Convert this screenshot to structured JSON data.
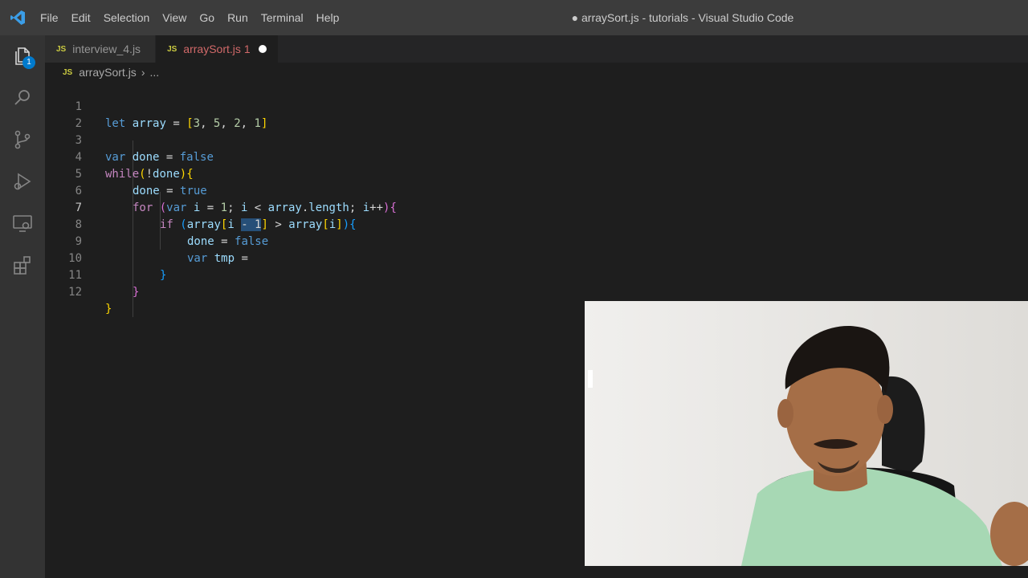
{
  "menu": [
    "File",
    "Edit",
    "Selection",
    "View",
    "Go",
    "Run",
    "Terminal",
    "Help"
  ],
  "window_title": "● arraySort.js - tutorials - Visual Studio Code",
  "activity": {
    "explorer_badge": "1",
    "icons": [
      "files-icon",
      "search-icon",
      "source-control-icon",
      "run-debug-icon",
      "remote-explorer-icon",
      "extensions-icon"
    ]
  },
  "tabs": [
    {
      "lang": "JS",
      "label": "interview_4.js"
    },
    {
      "lang": "JS",
      "label": "arraySort.js",
      "problems": "1"
    }
  ],
  "breadcrumb": {
    "lang": "JS",
    "file": "arraySort.js",
    "rest": "..."
  },
  "editor": {
    "line_numbers": [
      "1",
      "2",
      "3",
      "4",
      "5",
      "6",
      "7",
      "8",
      "9",
      "10",
      "11",
      "12"
    ],
    "current_line": 7,
    "tokens": {
      "l1_let": "let",
      "l1_array": "array",
      "l1_eq": " = ",
      "l1_ob": "[",
      "l1_n1": "3",
      "l1_c1": ", ",
      "l1_n2": "5",
      "l1_c2": ", ",
      "l1_n3": "2",
      "l1_c3": ", ",
      "l1_n4": "1",
      "l1_cb": "]",
      "l3_var": "var",
      "l3_done": "done",
      "l3_eq": " = ",
      "l3_false": "false",
      "l4_while": "while",
      "l4_op": "(",
      "l4_not": "!",
      "l4_done": "done",
      "l4_cp": ")",
      "l4_ob": "{",
      "l5_done": "done",
      "l5_eq": " = ",
      "l5_true": "true",
      "l6_for": "for",
      "l6_op": "(",
      "l6_var": "var",
      "l6_i": "i",
      "l6_eq": " = ",
      "l6_n1": "1",
      "l6_semi": "; ",
      "l6_i2": "i",
      "l6_lt": " < ",
      "l6_arr": "array",
      "l6_dot": ".",
      "l6_len": "length",
      "l6_semi2": "; ",
      "l6_i3": "i",
      "l6_inc": "++",
      "l6_cp": ")",
      "l6_ob": "{",
      "l7_if": "if",
      "l7_op": "(",
      "l7_arr": "array",
      "l7_sb": "[",
      "l7_i": "i ",
      "l7_sel": "- 1",
      "l7_sbe": "]",
      "l7_gt": " > ",
      "l7_arr2": "array",
      "l7_sb2": "[",
      "l7_i2": "i",
      "l7_sbe2": "]",
      "l7_cp": ")",
      "l7_ob": "{",
      "l8_done": "done",
      "l8_eq": " = ",
      "l8_false": "false",
      "l9_var": "var",
      "l9_tmp": "tmp",
      "l9_eq": " =",
      "l10_cb": "}",
      "l11_cb": "}",
      "l12_cb": "}"
    }
  },
  "colors": {
    "accent": "#007acc",
    "titlebar": "#3c3c3c",
    "editor_bg": "#1e1e1e"
  }
}
